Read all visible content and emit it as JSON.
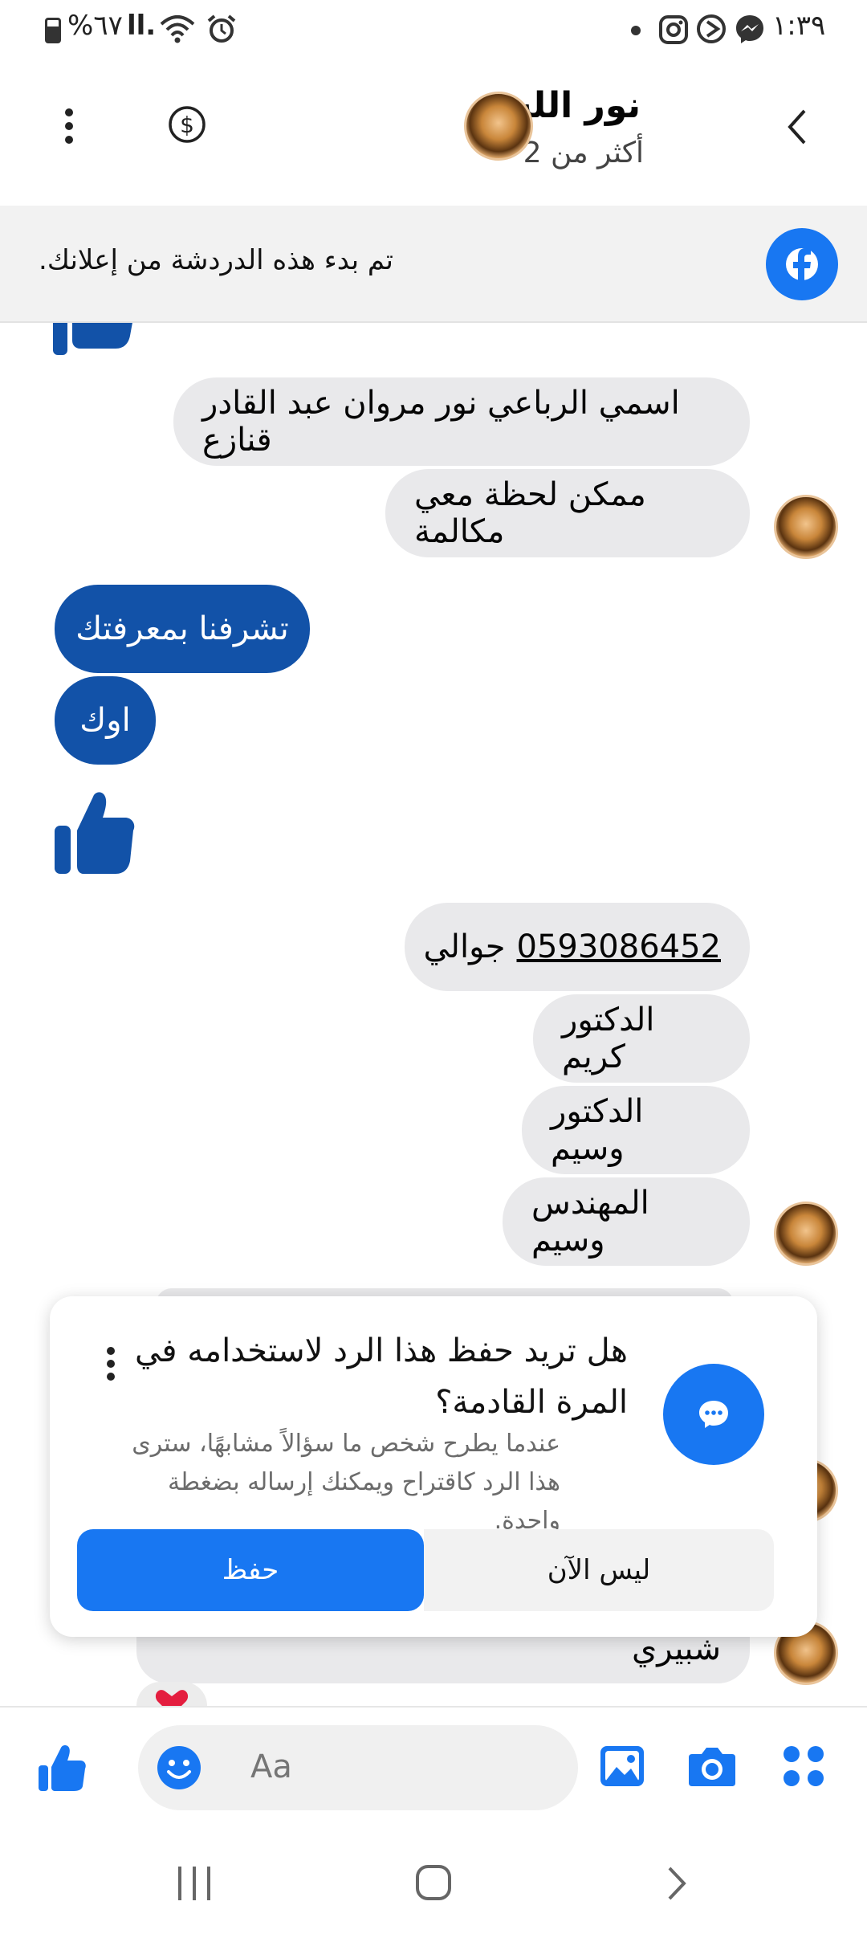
{
  "status_bar": {
    "battery": "%٦٧",
    "signal": "ll.",
    "time": "١:٣٩"
  },
  "header": {
    "title": "نور الله",
    "subtitle": "أكثر من 2"
  },
  "banner": {
    "text": ".تم بدء هذه الدردشة من إعلانك"
  },
  "messages": [
    {
      "text": "اسمي الرباعي نور مروان عبد القادر قنازع"
    },
    {
      "text": "ممكن لحظة معي مكالمة"
    },
    {
      "text": "تشرفنا بمعرفتك"
    },
    {
      "text": "اوك"
    },
    {
      "text": "جوالي",
      "phone": "0593086452"
    },
    {
      "text": "الدكتور كريم"
    },
    {
      "text": "الدكتور وسيم"
    },
    {
      "text": "المهندس وسيم"
    },
    {
      "text": "شبيري"
    }
  ],
  "popup": {
    "question": "هل تريد حفظ هذا الرد لاستخدامه في المرة القادمة؟",
    "description": "عندما يطرح شخص ما سؤالاً مشابهًا، سترى هذا الرد كاقتراح ويمكنك إرساله بضغطة واحدة.",
    "save_label": "حفظ",
    "later_label": "ليس الآن"
  },
  "composer": {
    "placeholder": "Aa"
  },
  "colors": {
    "messenger_blue": "#1877f2",
    "outgoing_bubble": "#1252a8",
    "incoming_bubble": "#e9e9eb"
  }
}
